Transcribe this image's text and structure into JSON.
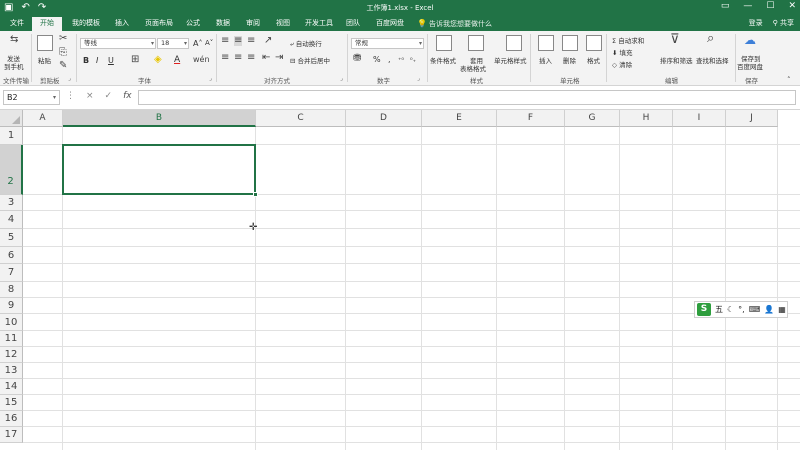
{
  "titlebar": {
    "title": "工作簿1.xlsx - Excel",
    "save_icon": "save-icon",
    "undo_icon": "undo-icon",
    "redo_icon": "redo-icon"
  },
  "tabs": [
    {
      "label": "文件"
    },
    {
      "label": "开始",
      "active": true
    },
    {
      "label": "我的模板"
    },
    {
      "label": "插入"
    },
    {
      "label": "页面布局"
    },
    {
      "label": "公式"
    },
    {
      "label": "数据"
    },
    {
      "label": "审阅"
    },
    {
      "label": "视图"
    },
    {
      "label": "开发工具"
    },
    {
      "label": "团队"
    },
    {
      "label": "百度网盘"
    }
  ],
  "tell_me": "告诉我您想要做什么",
  "account": {
    "sign_in": "登录",
    "share": "共享"
  },
  "ribbon": {
    "file_transfer": {
      "label1": "发送",
      "label2": "到手机",
      "group": "文件传输"
    },
    "clipboard": {
      "paste": "粘贴",
      "group": "剪贴板"
    },
    "font": {
      "name": "等线",
      "size": "18",
      "bold": "B",
      "italic": "I",
      "underline": "U",
      "font_color_glyph": "A",
      "group": "字体"
    },
    "alignment": {
      "wrap": "自动换行",
      "merge": "合并后居中",
      "group": "对齐方式"
    },
    "number": {
      "format": "常规",
      "percent": "%",
      "comma": ",",
      "group": "数字"
    },
    "styles": {
      "conditional": "条件格式",
      "table_line1": "套用",
      "table_line2": "表格格式",
      "cell_styles": "单元格样式",
      "group": "样式"
    },
    "cells": {
      "insert": "插入",
      "delete": "删除",
      "format": "格式",
      "group": "单元格"
    },
    "editing": {
      "autosum": "自动求和",
      "fill": "填充",
      "clear": "清除",
      "sort": "排序和筛选",
      "find": "查找和选择",
      "group": "编辑"
    },
    "save": {
      "line1": "保存到",
      "line2": "百度网盘",
      "group": "保存"
    }
  },
  "formula_bar": {
    "name_box": "B2",
    "cancel": "×",
    "enter": "✓",
    "fx": "fx",
    "formula": ""
  },
  "grid": {
    "columns": [
      "A",
      "B",
      "C",
      "D",
      "E",
      "F",
      "G",
      "H",
      "I",
      "J"
    ],
    "rows": [
      "1",
      "2",
      "3",
      "4",
      "5",
      "6",
      "7",
      "8",
      "9",
      "10",
      "11",
      "12",
      "13",
      "14",
      "15",
      "16",
      "17"
    ],
    "selected_column": "B",
    "selected_row": "2"
  },
  "ime": {
    "logo": "S",
    "mode": "五",
    "items": [
      "☾",
      "°,",
      "⌨",
      "👤",
      "▦"
    ]
  }
}
